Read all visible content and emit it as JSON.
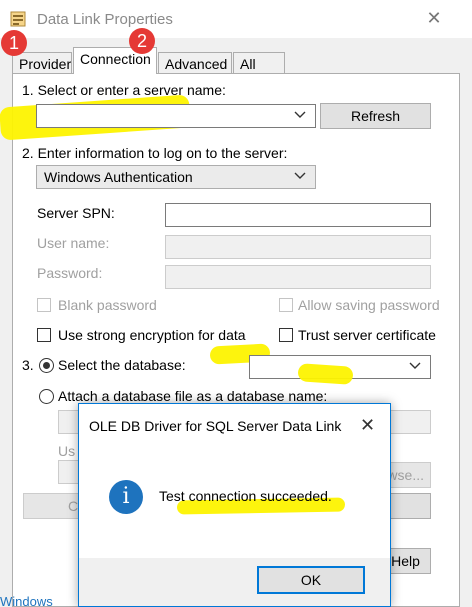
{
  "window": {
    "title": "Data Link Properties"
  },
  "tabs": [
    {
      "label": "Provider"
    },
    {
      "label": "Connection"
    },
    {
      "label": "Advanced"
    },
    {
      "label": "All"
    }
  ],
  "badges": [
    "1",
    "2"
  ],
  "connection": {
    "step1_label": "1. Select or enter a server name:",
    "server_name_value": "",
    "refresh_label": "Refresh",
    "step2_label": "2. Enter information to log on to the server:",
    "auth_value": "Windows Authentication",
    "server_spn_label": "Server SPN:",
    "user_name_label": "User name:",
    "password_label": "Password:",
    "blank_password_label": "Blank password",
    "allow_saving_label": "Allow saving password",
    "strong_encryption_label": "Use strong encryption for data",
    "trust_cert_label": "Trust server certificate",
    "step3_label": "3.",
    "select_db_label": "Select the database:",
    "select_db_value": "",
    "attach_db_label": "Attach a database file as a database name:",
    "browse_partial": "wse...",
    "use_partial": "Us",
    "c_partial": "C",
    "help_partial": "Help"
  },
  "dialog": {
    "title": "OLE DB Driver for SQL Server Data Link",
    "message": "Test connection succeeded.",
    "ok_label": "OK"
  },
  "background": {
    "partial_text": "Windows"
  },
  "colors": {
    "highlight": "#fdf300",
    "badge": "#e53935",
    "info": "#1e73be",
    "focus": "#0078d7"
  }
}
